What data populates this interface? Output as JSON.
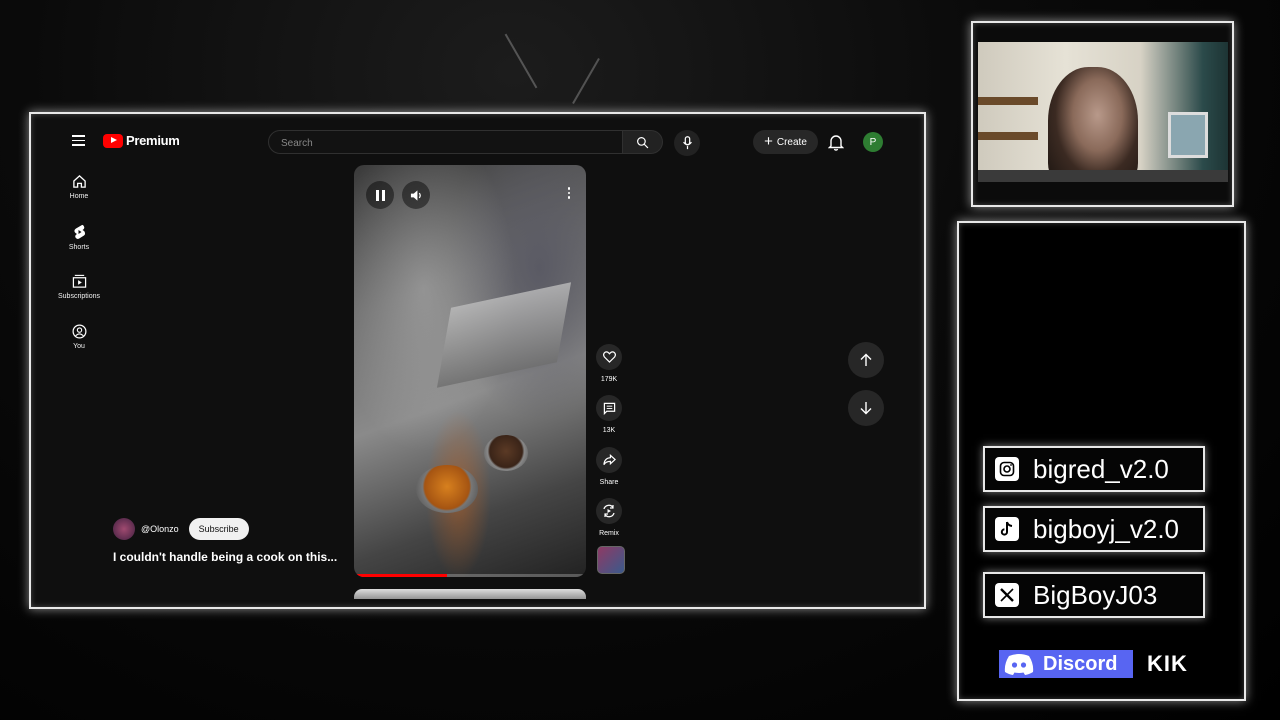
{
  "browser": {
    "logo_text": "Premium",
    "search_placeholder": "Search",
    "create_label": "Create",
    "avatar_letter": "P"
  },
  "nav": [
    {
      "label": "Home",
      "icon": "home-icon"
    },
    {
      "label": "Shorts",
      "icon": "shorts-icon"
    },
    {
      "label": "Subscriptions",
      "icon": "subscriptions-icon"
    },
    {
      "label": "You",
      "icon": "you-icon"
    }
  ],
  "short": {
    "channel": "@Olonzo",
    "subscribe_label": "Subscribe",
    "title": "I couldn't handle being a cook on this...",
    "progress_percent": 40,
    "actions": [
      {
        "label": "179K",
        "icon": "like-icon"
      },
      {
        "label": "13K",
        "icon": "comment-icon"
      },
      {
        "label": "Share",
        "icon": "share-icon"
      },
      {
        "label": "Remix",
        "icon": "remix-icon"
      }
    ]
  },
  "socials": [
    {
      "handle": "bigred_v2.0",
      "icon": "instagram-icon"
    },
    {
      "handle": "bigboyj_v2.0",
      "icon": "tiktok-icon"
    },
    {
      "handle": "BigBoyJ03",
      "icon": "x-icon"
    }
  ],
  "discord_label": "Discord",
  "kik_label": "KIK",
  "colors": {
    "accent_red": "#ff0000",
    "discord": "#5865f2",
    "avatar": "#2e7d32"
  }
}
